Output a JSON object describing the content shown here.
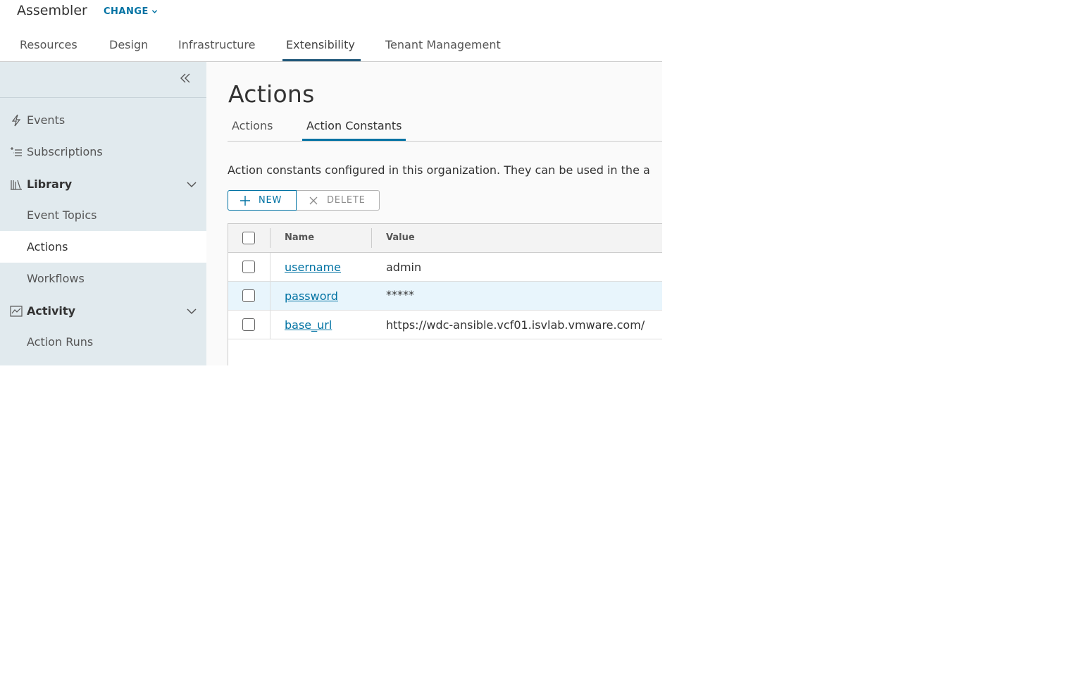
{
  "header": {
    "app_title": "Assembler",
    "change_label": "CHANGE"
  },
  "topnav": {
    "tabs": [
      "Resources",
      "Design",
      "Infrastructure",
      "Extensibility",
      "Tenant Management"
    ],
    "active": "Extensibility"
  },
  "sidebar": {
    "items": [
      {
        "label": "Events",
        "icon": "bolt-icon"
      },
      {
        "label": "Subscriptions",
        "icon": "subscriptions-icon"
      },
      {
        "label": "Library",
        "icon": "library-icon",
        "group": true,
        "expanded": true
      },
      {
        "label": "Event Topics"
      },
      {
        "label": "Actions",
        "selected": true
      },
      {
        "label": "Workflows"
      },
      {
        "label": "Activity",
        "icon": "activity-chart-icon",
        "group": true,
        "expanded": true
      },
      {
        "label": "Action Runs"
      }
    ]
  },
  "main": {
    "title": "Actions",
    "tabs": [
      "Actions",
      "Action Constants"
    ],
    "active_tab": "Action Constants",
    "description": "Action constants configured in this organization. They can be used in the a",
    "buttons": {
      "new_label": "NEW",
      "delete_label": "DELETE"
    },
    "grid": {
      "columns": [
        "Name",
        "Value"
      ],
      "rows": [
        {
          "name": "username",
          "value": "admin"
        },
        {
          "name": "password",
          "value": "*****"
        },
        {
          "name": "base_url",
          "value": "https://wdc-ansible.vcf01.isvlab.vmware.com/"
        }
      ]
    }
  },
  "colors": {
    "accent": "#0072a3",
    "sidebar_bg": "#e1eaee",
    "row_highlight": "#e8f5fc"
  }
}
